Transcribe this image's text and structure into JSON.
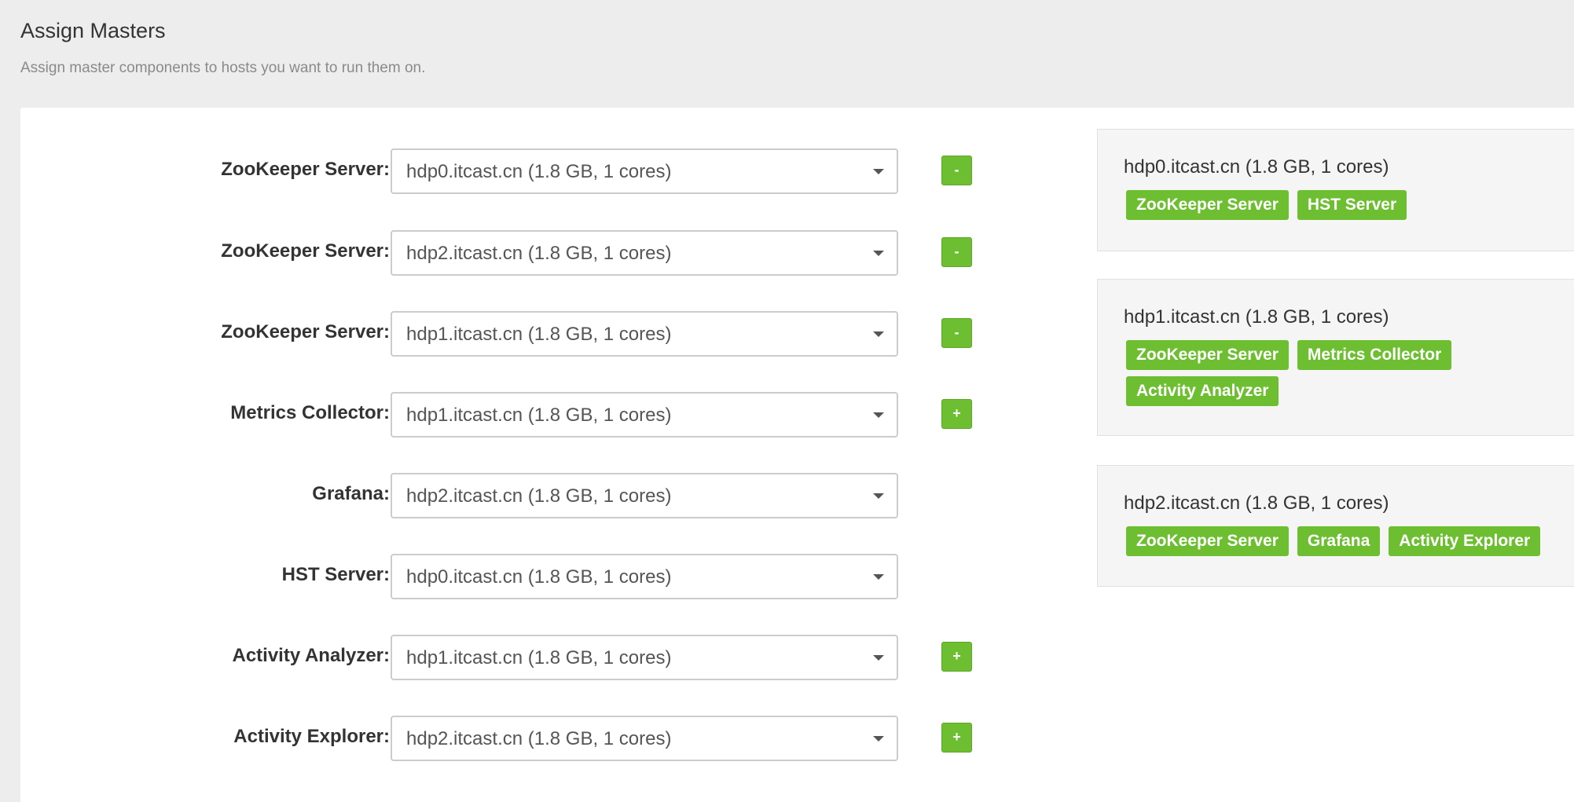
{
  "header": {
    "title": "Assign Masters",
    "subtitle": "Assign master components to hosts you want to run them on."
  },
  "assignments": [
    {
      "label": "ZooKeeper Server:",
      "host": "hdp0.itcast.cn (1.8 GB, 1 cores)",
      "action": "-"
    },
    {
      "label": "ZooKeeper Server:",
      "host": "hdp2.itcast.cn (1.8 GB, 1 cores)",
      "action": "-"
    },
    {
      "label": "ZooKeeper Server:",
      "host": "hdp1.itcast.cn (1.8 GB, 1 cores)",
      "action": "-"
    },
    {
      "label": "Metrics Collector:",
      "host": "hdp1.itcast.cn (1.8 GB, 1 cores)",
      "action": "+"
    },
    {
      "label": "Grafana:",
      "host": "hdp2.itcast.cn (1.8 GB, 1 cores)",
      "action": ""
    },
    {
      "label": "HST Server:",
      "host": "hdp0.itcast.cn (1.8 GB, 1 cores)",
      "action": ""
    },
    {
      "label": "Activity Analyzer:",
      "host": "hdp1.itcast.cn (1.8 GB, 1 cores)",
      "action": "+"
    },
    {
      "label": "Activity Explorer:",
      "host": "hdp2.itcast.cn (1.8 GB, 1 cores)",
      "action": "+"
    }
  ],
  "hosts": [
    {
      "name": "hdp0.itcast.cn (1.8 GB, 1 cores)",
      "components": [
        "ZooKeeper Server",
        "HST Server"
      ]
    },
    {
      "name": "hdp1.itcast.cn (1.8 GB, 1 cores)",
      "components": [
        "ZooKeeper Server",
        "Metrics Collector",
        "Activity Analyzer"
      ]
    },
    {
      "name": "hdp2.itcast.cn (1.8 GB, 1 cores)",
      "components": [
        "ZooKeeper Server",
        "Grafana",
        "Activity Explorer"
      ]
    }
  ],
  "colors": {
    "accent": "#6ebe32",
    "background": "#ededed",
    "panel": "#ffffff"
  },
  "icons": {
    "dropdown": "caret-down-icon"
  }
}
